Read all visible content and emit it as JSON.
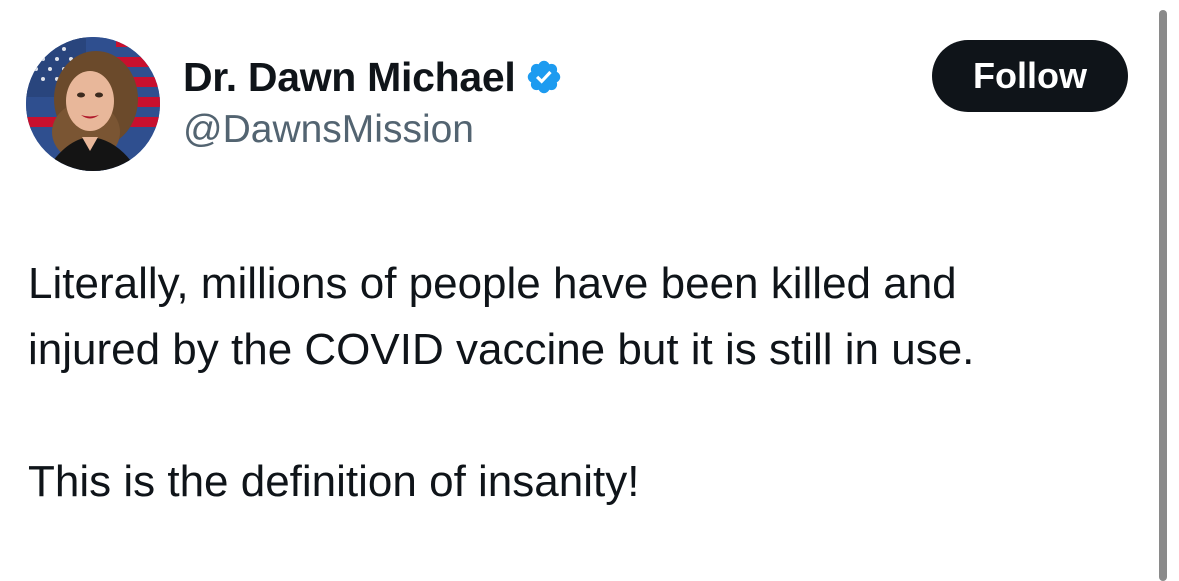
{
  "author": {
    "display_name": "Dr. Dawn Michael",
    "handle": "@DawnsMission",
    "verified": true,
    "avatar_icon": "profile-photo"
  },
  "actions": {
    "follow_label": "Follow"
  },
  "tweet": {
    "lines": [
      "Literally, millions of people have been killed and",
      "injured by the COVID vaccine but it is still in use.",
      "This is the definition of insanity!"
    ]
  },
  "colors": {
    "text_primary": "#0f1419",
    "text_secondary": "#536471",
    "verified_blue": "#1d9bf0",
    "button_bg": "#0f1419",
    "button_text": "#ffffff"
  }
}
